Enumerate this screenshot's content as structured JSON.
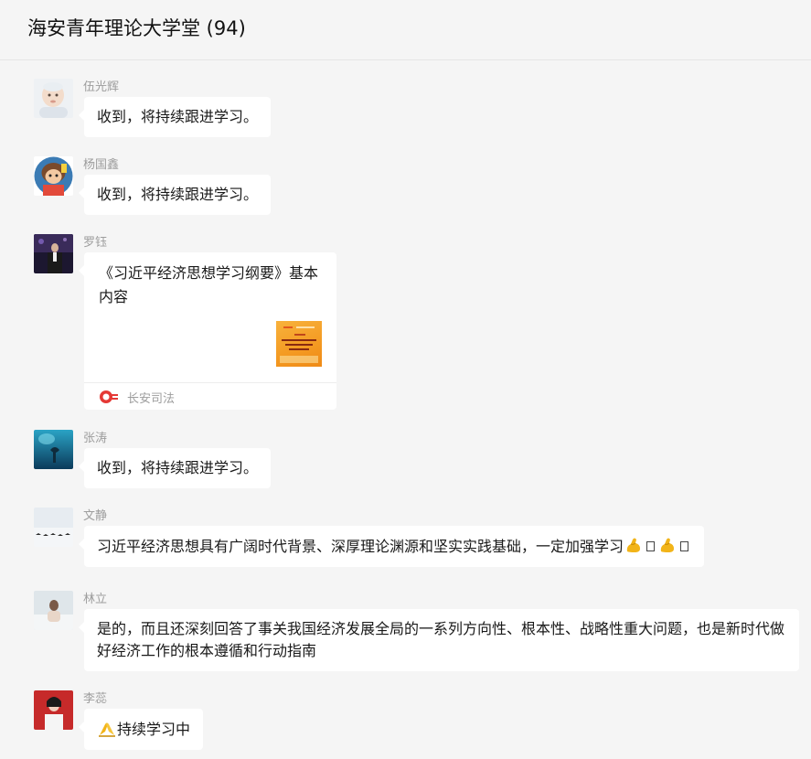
{
  "header": {
    "title": "海安青年理论大学堂 (94)"
  },
  "messages": [
    {
      "sender": "伍光辉",
      "text": "收到，将持续跟进学习。",
      "avatar_icon": "baby-photo-avatar"
    },
    {
      "sender": "杨国鑫",
      "text": "收到，将持续跟进学习。",
      "avatar_icon": "cartoon-avatar"
    },
    {
      "sender": "罗钰",
      "card": {
        "title": "《习近平经济思想学习纲要》基本内容",
        "source": "长安司法",
        "thumb_icon": "article-thumbnail",
        "source_icon": "changan-sifa-logo"
      },
      "avatar_icon": "speaker-stage-avatar"
    },
    {
      "sender": "张涛",
      "text": "收到，将持续跟进学习。",
      "avatar_icon": "underwater-avatar"
    },
    {
      "sender": "文静",
      "text": "习近平经济思想具有广阔时代背景、深厚理论渊源和坚实实践基础，一定加强学习",
      "emoji": "flexed-biceps-icon",
      "avatar_icon": "birds-snow-avatar"
    },
    {
      "sender": "林立",
      "text": "是的，而且还深刻回答了事关我国经济发展全局的一系列方向性、根本性、战略性重大问题，也是新时代做好经济工作的根本遵循和行动指南",
      "avatar_icon": "person-snow-avatar"
    },
    {
      "sender": "李蕊",
      "text": "持续学习中",
      "emoji": "folded-hands-icon",
      "avatar_icon": "red-portrait-avatar"
    }
  ],
  "colors": {
    "background": "#f5f5f5",
    "bubble": "#ffffff",
    "name": "#9d9d9d",
    "text": "#191919"
  }
}
